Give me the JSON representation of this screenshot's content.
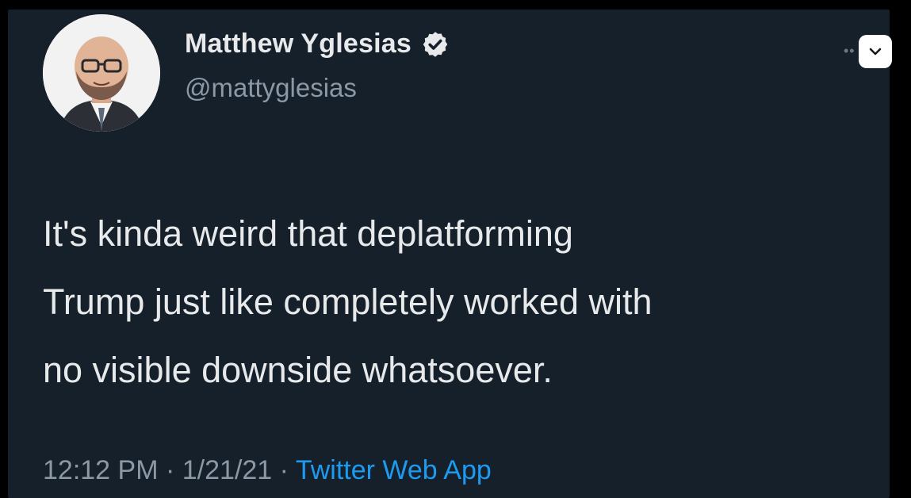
{
  "author": {
    "display_name": "Matthew Yglesias",
    "handle": "@mattyglesias",
    "verified_icon": "verified-badge-icon"
  },
  "tweet": {
    "lines": [
      "It's kinda weird that deplatforming",
      "Trump just like completely worked with",
      "no visible downside whatsoever."
    ]
  },
  "meta": {
    "time": "12:12 PM",
    "separator": "·",
    "date": "1/21/21",
    "source": "Twitter Web App"
  },
  "colors": {
    "background": "#15202b",
    "primary_text": "#e7e9ea",
    "secondary_text": "#8b98a5",
    "link": "#1d9bf0"
  },
  "icons": {
    "more": "more-options-icon",
    "chevron": "chevron-down-icon"
  }
}
